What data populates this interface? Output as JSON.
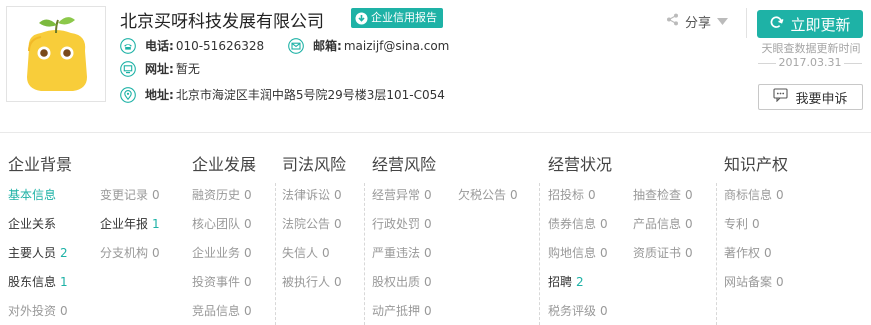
{
  "company": {
    "name": "北京买呀科技发展有限公司",
    "report_label": "企业信用报告",
    "phone_label": "电话:",
    "phone": "010-51626328",
    "email_label": "邮箱:",
    "email": "maizijf@sina.com",
    "website_label": "网址:",
    "website": "暂无",
    "address_label": "地址:",
    "address": "北京市海淀区丰润中路5号院29号楼3层101-C054"
  },
  "actions": {
    "share_label": "分享",
    "update_label": "立即更新",
    "update_note": "天眼查数据更新时间",
    "update_date": "2017.03.31",
    "complain_label": "我要申诉"
  },
  "sections": {
    "background": {
      "title": "企业背景",
      "items": [
        {
          "label": "基本信息",
          "count": ""
        },
        {
          "label": "变更记录",
          "count": "0"
        },
        {
          "label": "企业关系",
          "count": ""
        },
        {
          "label": "企业年报",
          "count": "1"
        },
        {
          "label": "主要人员",
          "count": "2"
        },
        {
          "label": "分支机构",
          "count": "0"
        },
        {
          "label": "股东信息",
          "count": "1"
        },
        {
          "label": "对外投资",
          "count": "0"
        }
      ]
    },
    "development": {
      "title": "企业发展",
      "items": [
        {
          "label": "融资历史",
          "count": "0"
        },
        {
          "label": "核心团队",
          "count": "0"
        },
        {
          "label": "企业业务",
          "count": "0"
        },
        {
          "label": "投资事件",
          "count": "0"
        },
        {
          "label": "竞品信息",
          "count": "0"
        }
      ]
    },
    "judicial": {
      "title": "司法风险",
      "items": [
        {
          "label": "法律诉讼",
          "count": "0"
        },
        {
          "label": "法院公告",
          "count": "0"
        },
        {
          "label": "失信人",
          "count": "0"
        },
        {
          "label": "被执行人",
          "count": "0"
        }
      ]
    },
    "operational_risk": {
      "title": "经营风险",
      "items": [
        {
          "label": "经营异常",
          "count": "0"
        },
        {
          "label": "欠税公告",
          "count": "0"
        },
        {
          "label": "行政处罚",
          "count": "0"
        },
        {
          "label": "严重违法",
          "count": "0"
        },
        {
          "label": "股权出质",
          "count": "0"
        },
        {
          "label": "动产抵押",
          "count": "0"
        }
      ]
    },
    "operating_status": {
      "title": "经营状况",
      "items": [
        {
          "label": "招投标",
          "count": "0"
        },
        {
          "label": "抽查检查",
          "count": "0"
        },
        {
          "label": "债券信息",
          "count": "0"
        },
        {
          "label": "产品信息",
          "count": "0"
        },
        {
          "label": "购地信息",
          "count": "0"
        },
        {
          "label": "资质证书",
          "count": "0"
        },
        {
          "label": "招聘",
          "count": "2"
        },
        {
          "label": "税务评级",
          "count": "0"
        }
      ]
    },
    "ip": {
      "title": "知识产权",
      "items": [
        {
          "label": "商标信息",
          "count": "0"
        },
        {
          "label": "专利",
          "count": "0"
        },
        {
          "label": "著作权",
          "count": "0"
        },
        {
          "label": "网站备案",
          "count": "0"
        }
      ]
    }
  },
  "colors": {
    "accent": "#1eb2a6",
    "muted": "#999999",
    "text": "#333333"
  }
}
